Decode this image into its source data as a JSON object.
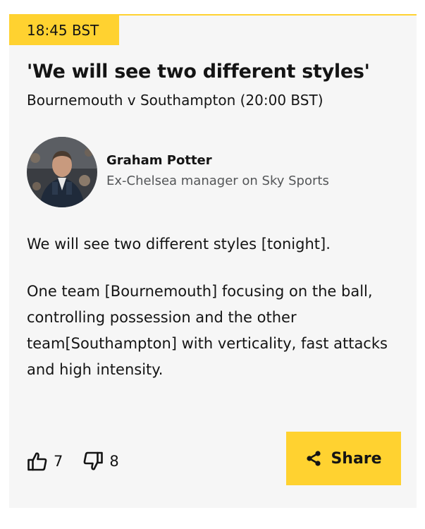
{
  "post": {
    "time": "18:45 BST",
    "headline": "'We will see two different styles'",
    "subheadline": "Bournemouth v Southampton (20:00 BST)",
    "author": {
      "name": "Graham Potter",
      "role": "Ex-Chelsea manager on Sky Sports",
      "avatar_icon": "person-photo-icon"
    },
    "paragraphs": [
      "We will see two different styles [tonight].",
      "One team [Bournemouth] focusing on the ball, controlling possession and the other team[Southampton] with verticality, fast attacks and high intensity."
    ]
  },
  "reactions": {
    "like_icon": "thumbs-up-icon",
    "like_count": "7",
    "dislike_icon": "thumbs-down-icon",
    "dislike_count": "8"
  },
  "share": {
    "icon": "share-icon",
    "label": "Share"
  },
  "colors": {
    "accent": "#ffd230",
    "card_background": "#f6f6f6",
    "text": "#141414",
    "muted_text": "#545658"
  }
}
